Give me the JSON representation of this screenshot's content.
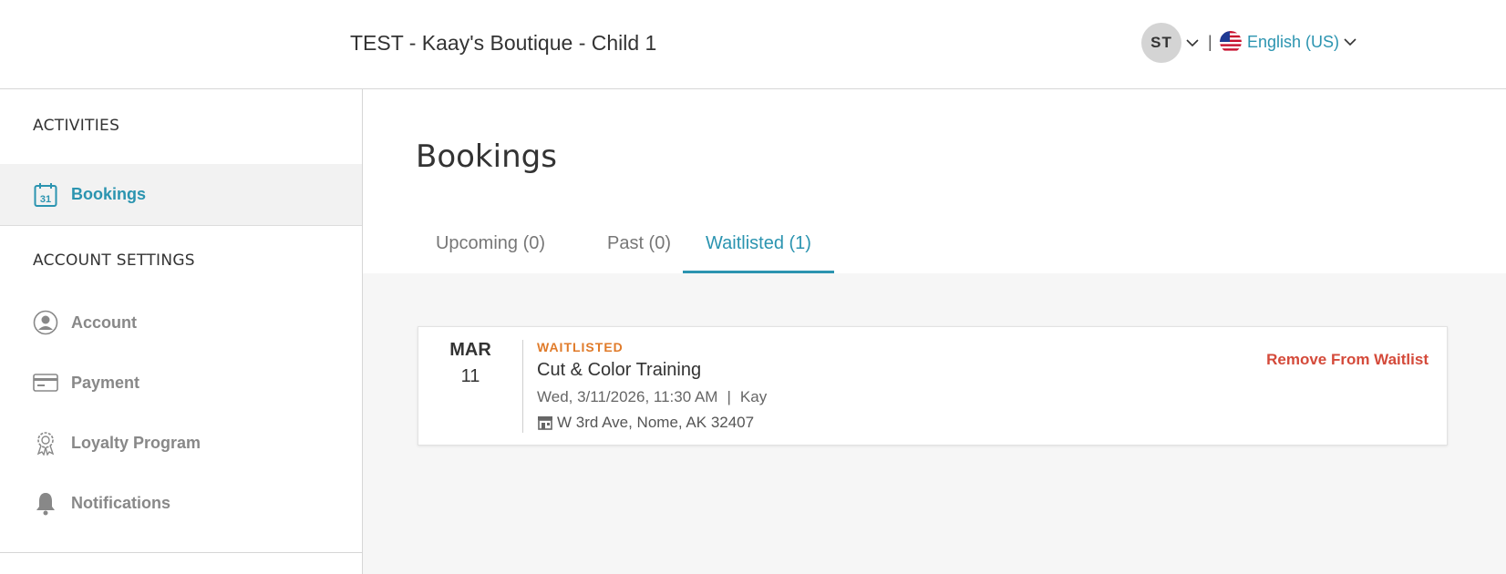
{
  "header": {
    "store_title": "TEST - Kaay's Boutique - Child 1",
    "avatar_initials": "ST",
    "separator": "|",
    "language": "English (US)"
  },
  "sidebar": {
    "activities_heading": "ACTIVITIES",
    "bookings_label": "Bookings",
    "calendar_day": "31",
    "account_settings_heading": "ACCOUNT SETTINGS",
    "items": [
      {
        "label": "Account",
        "icon": "account-icon"
      },
      {
        "label": "Payment",
        "icon": "payment-card-icon"
      },
      {
        "label": "Loyalty Program",
        "icon": "loyalty-badge-icon"
      },
      {
        "label": "Notifications",
        "icon": "bell-icon"
      }
    ]
  },
  "main": {
    "title": "Bookings",
    "tabs": [
      {
        "label": "Upcoming (0)",
        "active": false
      },
      {
        "label": "Past (0)",
        "active": false
      },
      {
        "label": "Waitlisted (1)",
        "active": true
      }
    ],
    "booking": {
      "month": "MAR",
      "day": "11",
      "status": "WAITLISTED",
      "class_name": "Cut & Color Training",
      "datetime": "Wed, 3/11/2026, 11:30 AM",
      "pipe": "|",
      "instructor": "Kay",
      "address": "W 3rd Ave, Nome, AK 32407",
      "remove_label": "Remove From Waitlist"
    }
  },
  "colors": {
    "accent": "#2b94b0",
    "status_orange": "#e07b2a",
    "remove_red": "#d44a3a"
  }
}
